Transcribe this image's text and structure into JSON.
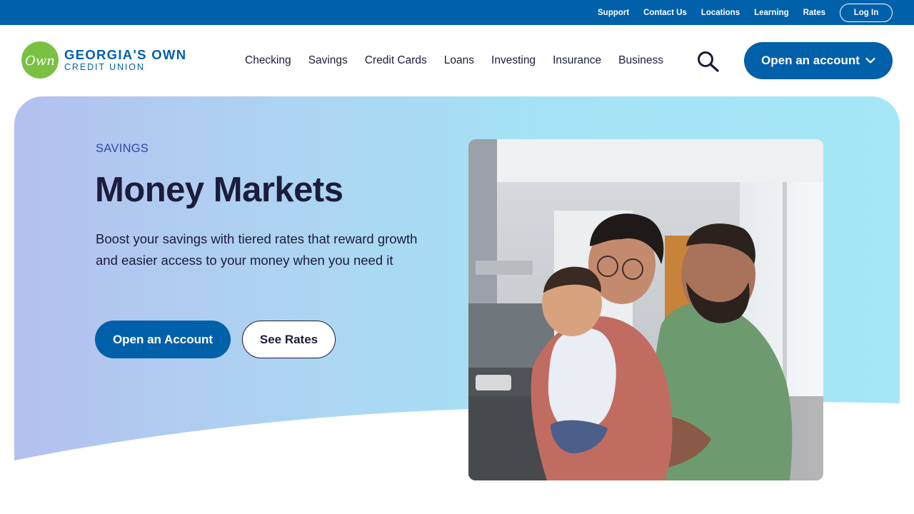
{
  "utility_nav": {
    "links": [
      "Support",
      "Contact Us",
      "Locations",
      "Learning",
      "Rates"
    ],
    "login_label": "Log In"
  },
  "header": {
    "logo": {
      "mark_text": "Own",
      "name_line1": "GEORGIA'S OWN",
      "name_line2": "CREDIT UNION"
    },
    "nav_items": [
      "Checking",
      "Savings",
      "Credit Cards",
      "Loans",
      "Investing",
      "Insurance",
      "Business"
    ],
    "search_icon": "search-icon",
    "open_account_label": "Open an account"
  },
  "hero": {
    "eyebrow": "SAVINGS",
    "title": "Money Markets",
    "description": "Boost your savings with tiered rates that reward growth and easier access to your money when you need it",
    "primary_cta": "Open an Account",
    "secondary_cta": "See Rates",
    "image_subject": "family-photo"
  },
  "colors": {
    "brand_blue": "#0060a9",
    "brand_green": "#7ac143",
    "text_dark": "#1b1d3a",
    "eyebrow_blue": "#2a49a8"
  }
}
